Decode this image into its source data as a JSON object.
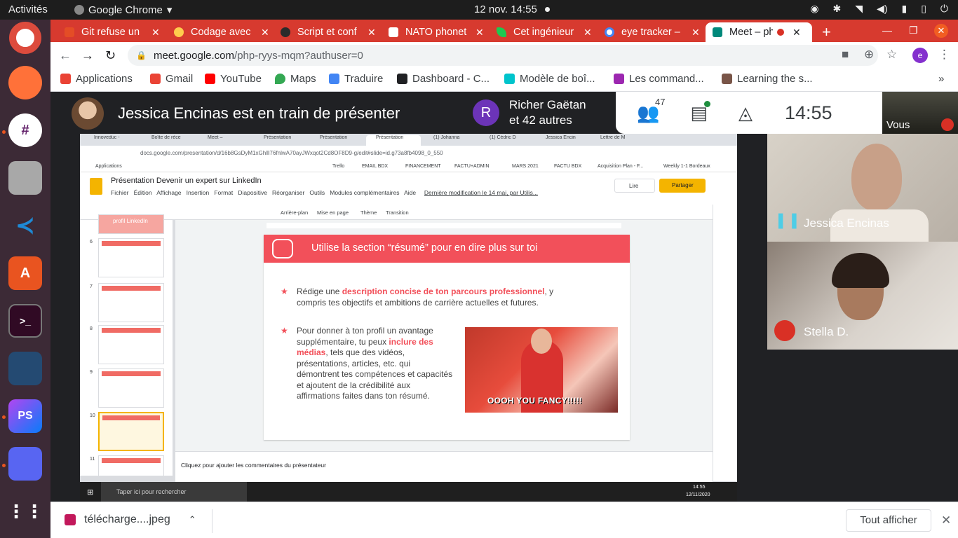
{
  "topbar": {
    "activities": "Activités",
    "app_name": "Google Chrome",
    "clock": "12 nov.  14:55"
  },
  "browser": {
    "tabs": [
      {
        "label": "Git refuse un",
        "icon_color": "#e44d26"
      },
      {
        "label": "Codage avec",
        "icon_color": "#ffcc4d"
      },
      {
        "label": "Script et conf",
        "icon_color": "#2b2b2b"
      },
      {
        "label": "NATO phonet",
        "icon_color": "#ffffff"
      },
      {
        "label": "Cet ingénieur",
        "icon_color": "#1ec850"
      },
      {
        "label": "eye tracker – ",
        "icon_color": "#4285f4"
      },
      {
        "label": "Meet – ph",
        "icon_color": "#00897b",
        "active": true
      }
    ],
    "url_host": "meet.google.com",
    "url_path": "/php-ryys-mqm?authuser=0",
    "profile_initial": "e",
    "bookmarks": [
      {
        "label": "Applications",
        "icon_color": "#ea4335"
      },
      {
        "label": "Gmail",
        "icon_color": "#ea4335"
      },
      {
        "label": "YouTube",
        "icon_color": "#ff0000"
      },
      {
        "label": "Maps",
        "icon_color": "#34a853"
      },
      {
        "label": "Traduire",
        "icon_color": "#4285f4"
      },
      {
        "label": "Dashboard - C...",
        "icon_color": "#202124"
      },
      {
        "label": "Modèle de boî...",
        "icon_color": "#00c4cc"
      },
      {
        "label": "Les command...",
        "icon_color": "#9c27b0"
      },
      {
        "label": "Learning the s...",
        "icon_color": "#795548"
      }
    ]
  },
  "meet": {
    "presenter_banner": "Jessica Encinas est en train de présenter",
    "participants_group": {
      "initial": "R",
      "line1": "Richer Gaëtan",
      "line2": "et 42 autres"
    },
    "participant_count": "47",
    "time": "14:55",
    "self_label": "Vous",
    "tiles": [
      {
        "name": "Jessica Encinas"
      },
      {
        "name": "Stella D."
      }
    ]
  },
  "shared_screen": {
    "inner_tabs": [
      "Innoveduc -",
      "Boîte de réce",
      "Meet – ",
      "Présentation",
      "Présentation",
      "Présentation",
      "(1) Johanna",
      "(1) Cédric D",
      "Jessica Encin",
      "Lettre de M"
    ],
    "url": "docs.google.com/presentation/d/16b8GsDyM1xGhlll76fnlwA70ayJWxqot2Cd8OF8D9-g/edit#slide=id.g73a8fb4098_0_550",
    "inner_bookmarks": [
      "Applications",
      "Trello",
      "EMAIL BDX",
      "FINANCEMENT",
      "FACTU+ADMIN",
      "MARS 2021",
      "FACTU BDX",
      "Acquisition Plan - F...",
      "Weekly 1-1 Bordeaux"
    ],
    "doc_title": "Présentation Devenir un expert sur LinkedIn",
    "menu": [
      "Fichier",
      "Édition",
      "Affichage",
      "Insertion",
      "Format",
      "Diapositive",
      "Réorganiser",
      "Outils",
      "Modules complémentaires",
      "Aide"
    ],
    "last_edit": "Dernière modification le 14 mai, par Utilis...",
    "lire": "Lire",
    "partager": "Partager",
    "toolbar": [
      "Arrière-plan",
      "Mise en page",
      "Thème",
      "Transition"
    ],
    "thumb_top_label": "profil LinkedIn",
    "thumbs": [
      "6",
      "7",
      "8",
      "9",
      "10",
      "11"
    ],
    "slide": {
      "title": "Utilise la section “résumé” pour en dire plus sur toi",
      "bullet1_a": "Rédige une ",
      "bullet1_em": "description concise de ton parcours professionnel",
      "bullet1_b": ", y compris tes objectifs et ambitions de carrière actuelles et futures.",
      "bullet2_a": "Pour donner à ton profil un avantage supplémentaire, tu peux ",
      "bullet2_em": "inclure des médias",
      "bullet2_b": ", tels que des vidéos, présentations, articles, etc. qui démontrent tes compétences et capacités et ajoutent de la crédibilité aux affirmations faites dans ton résumé.",
      "gif_caption": "OOOH YOU FANCY!!!!!"
    },
    "notes_placeholder": "Cliquez pour ajouter les commentaires du présentateur",
    "taskbar_search": "Taper ici pour rechercher",
    "taskbar_time": "14:55",
    "taskbar_date": "12/11/2020"
  },
  "download_bar": {
    "file": "télécharge....jpeg",
    "show_all": "Tout afficher"
  }
}
